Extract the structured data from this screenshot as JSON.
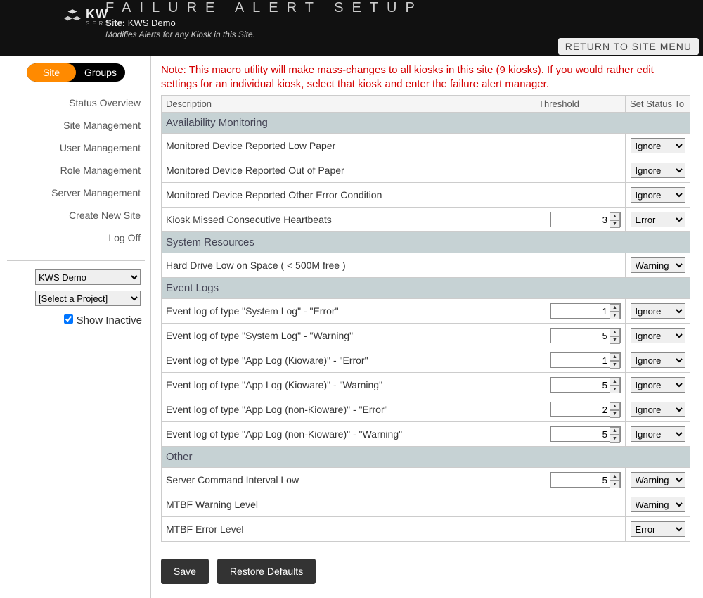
{
  "header": {
    "logo_main": "KW",
    "logo_sub": "SERVER",
    "title": "FAILURE ALERT SETUP",
    "site_prefix": "Site:",
    "site_name": "KWS Demo",
    "subtitle": "Modifies Alerts for any Kiosk in this Site.",
    "return_button": "RETURN TO SITE MENU"
  },
  "sidebar": {
    "tabs": {
      "site": "Site",
      "groups": "Groups",
      "active": "site"
    },
    "items": [
      "Status Overview",
      "Site Management",
      "User Management",
      "Role Management",
      "Server Management",
      "Create New Site",
      "Log Off"
    ],
    "site_select": "KWS Demo",
    "project_select": "[Select a Project]",
    "show_inactive_label": "Show Inactive",
    "show_inactive_checked": true
  },
  "note": "Note: This macro utility will make mass-changes to all kiosks in this site (9 kiosks). If you would rather edit settings for an individual kiosk, select that kiosk and enter the failure alert manager.",
  "columns": {
    "description": "Description",
    "threshold": "Threshold",
    "status": "Set Status To"
  },
  "status_options": [
    "Ignore",
    "Warning",
    "Error"
  ],
  "sections": [
    {
      "title": "Availability Monitoring",
      "rows": [
        {
          "desc": "Monitored Device Reported Low Paper",
          "threshold": null,
          "status": "Ignore"
        },
        {
          "desc": "Monitored Device Reported Out of Paper",
          "threshold": null,
          "status": "Ignore"
        },
        {
          "desc": "Monitored Device Reported Other Error Condition",
          "threshold": null,
          "status": "Ignore"
        },
        {
          "desc": "Kiosk Missed Consecutive Heartbeats",
          "threshold": 3,
          "status": "Error"
        }
      ]
    },
    {
      "title": "System Resources",
      "rows": [
        {
          "desc": "Hard Drive Low on Space ( < 500M free )",
          "threshold": null,
          "status": "Warning"
        }
      ]
    },
    {
      "title": "Event Logs",
      "rows": [
        {
          "desc": "Event log of type \"System Log\" - \"Error\"",
          "threshold": 1,
          "status": "Ignore"
        },
        {
          "desc": "Event log of type \"System Log\" - \"Warning\"",
          "threshold": 5,
          "status": "Ignore"
        },
        {
          "desc": "Event log of type \"App Log (Kioware)\" - \"Error\"",
          "threshold": 1,
          "status": "Ignore"
        },
        {
          "desc": "Event log of type \"App Log (Kioware)\" - \"Warning\"",
          "threshold": 5,
          "status": "Ignore"
        },
        {
          "desc": "Event log of type \"App Log (non-Kioware)\" - \"Error\"",
          "threshold": 2,
          "status": "Ignore"
        },
        {
          "desc": "Event log of type \"App Log (non-Kioware)\" - \"Warning\"",
          "threshold": 5,
          "status": "Ignore"
        }
      ]
    },
    {
      "title": "Other",
      "rows": [
        {
          "desc": "Server Command Interval Low",
          "threshold": 5,
          "status": "Warning"
        },
        {
          "desc": "MTBF Warning Level",
          "threshold": null,
          "status": "Warning"
        },
        {
          "desc": "MTBF Error Level",
          "threshold": null,
          "status": "Error"
        }
      ]
    }
  ],
  "buttons": {
    "save": "Save",
    "restore": "Restore Defaults"
  }
}
